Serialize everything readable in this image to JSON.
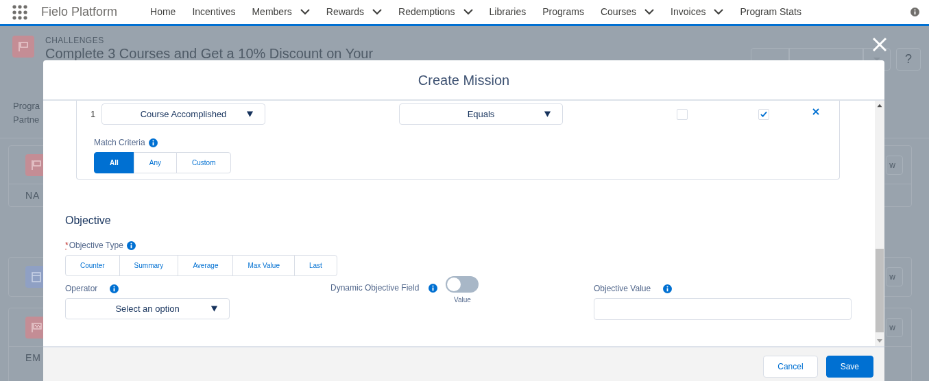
{
  "nav": {
    "app_name": "Fielo Platform",
    "items": [
      {
        "label": "Home",
        "dropdown": false
      },
      {
        "label": "Incentives",
        "dropdown": false
      },
      {
        "label": "Members",
        "dropdown": true
      },
      {
        "label": "Rewards",
        "dropdown": true
      },
      {
        "label": "Redemptions",
        "dropdown": true
      },
      {
        "label": "Libraries",
        "dropdown": false
      },
      {
        "label": "Programs",
        "dropdown": false
      },
      {
        "label": "Courses",
        "dropdown": true
      },
      {
        "label": "Invoices",
        "dropdown": true
      },
      {
        "label": "Program Stats",
        "dropdown": false
      }
    ]
  },
  "background": {
    "section": "CHALLENGES",
    "title": "Complete 3 Courses and Get a 10% Discount on Your",
    "header_buttons": [
      {
        "kind": "plain"
      },
      {
        "kind": "wide"
      }
    ],
    "help_button": "?",
    "fields": [
      "Progra",
      "Partne"
    ],
    "cards": [
      {
        "kind": "flag",
        "label": "NA",
        "button": "w"
      },
      {
        "kind": "calendar",
        "button": "w"
      },
      {
        "kind": "checkered",
        "label": "EM",
        "button": "w"
      }
    ]
  },
  "modal": {
    "title": "Create Mission",
    "criteria": [
      {
        "index": "1",
        "field": "Course Accomplished",
        "operator": "Equals",
        "flags": [
          {
            "checked": false
          },
          {
            "checked": true
          }
        ]
      }
    ],
    "match_criteria": {
      "label": "Match Criteria",
      "options": [
        {
          "label": "All",
          "selected": true
        },
        {
          "label": "Any",
          "selected": false
        },
        {
          "label": "Custom",
          "selected": false
        }
      ]
    },
    "objective": {
      "heading": "Objective",
      "type_label": "Objective Type",
      "required_mark": "*",
      "types": [
        {
          "label": "Counter",
          "selected": false
        },
        {
          "label": "Summary",
          "selected": false
        },
        {
          "label": "Average",
          "selected": false
        },
        {
          "label": "Max Value",
          "selected": false
        },
        {
          "label": "Last",
          "selected": false
        }
      ],
      "operator": {
        "label": "Operator",
        "placeholder": "Select an option"
      },
      "dynamic": {
        "label": "Dynamic Objective Field",
        "on": false,
        "caption": "Value"
      },
      "value": {
        "label": "Objective Value"
      }
    },
    "buttons": [
      {
        "label": "Cancel",
        "kind": "neutral"
      },
      {
        "label": "Save",
        "kind": "brand"
      }
    ]
  }
}
